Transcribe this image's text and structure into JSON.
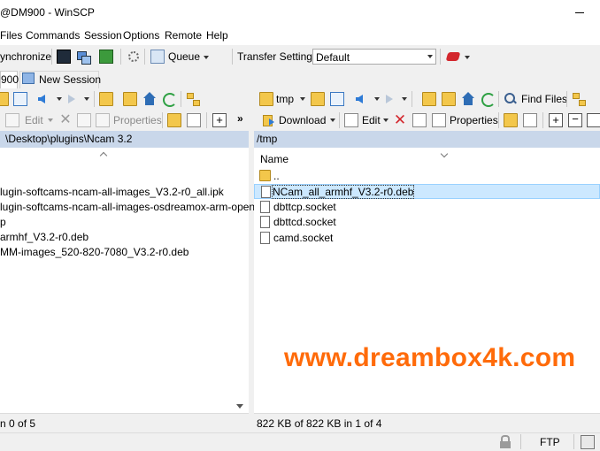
{
  "window": {
    "title": "@DM900 - WinSCP"
  },
  "menu": {
    "items": [
      "Files",
      "Commands",
      "Session",
      "Options",
      "Remote",
      "Help"
    ]
  },
  "toolbar": {
    "synchronize_label": "ynchronize",
    "queue_label": "Queue",
    "transfer_settings_label": "Transfer Settings",
    "transfer_settings_value": "Default"
  },
  "tabs": {
    "session_tab": "900",
    "new_session": "New Session"
  },
  "local": {
    "path": "\\Desktop\\plugins\\Ncam 3.2",
    "edit_label": "Edit",
    "properties_label": "Properties",
    "files": [
      "lugin-softcams-ncam-all-images_V3.2-r0_all.ipk",
      "lugin-softcams-ncam-all-images-osdreamox-arm-open-s",
      "p",
      "armhf_V3.2-r0.deb",
      "MM-images_520-820-7080_V3.2-r0.deb"
    ],
    "status": "n 0 of 5"
  },
  "remote": {
    "dir_dropdown": "tmp",
    "find_files_label": "Find Files",
    "download_label": "Download",
    "edit_label": "Edit",
    "properties_label": "Properties",
    "path": "/tmp",
    "column_name": "Name",
    "parent": "..",
    "files": [
      "NCam_all_armhf_V3.2-r0.deb",
      "dbttcp.socket",
      "dbttcd.socket",
      "camd.socket"
    ],
    "selected_index": 0,
    "status": "822 KB of 822 KB in 1 of 4"
  },
  "bottom": {
    "protocol": "FTP"
  },
  "watermark": "www.dreambox4k.com",
  "colors": {
    "path_bar": "#c9d7ea",
    "selection": "#cce8ff",
    "watermark": "#ff6b0a",
    "folder": "#f3c74b"
  }
}
